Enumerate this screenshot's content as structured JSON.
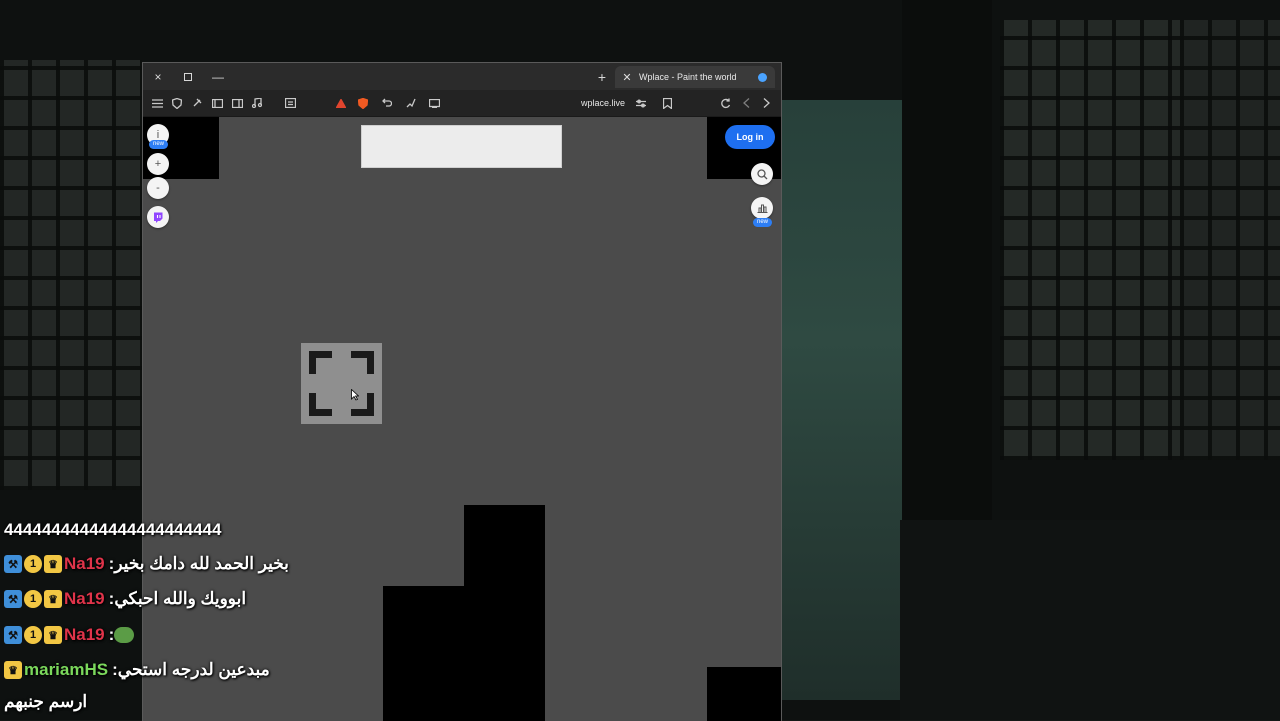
{
  "browser": {
    "tab_title": "Wplace - Paint the world",
    "url": "wplace.live",
    "new_tab_label": "+",
    "close_label": "×",
    "min_label": "—"
  },
  "page": {
    "login_label": "Log in",
    "left_badge": "new",
    "right_badge": "new",
    "info_glyph": "i",
    "zoom_in_glyph": "+",
    "zoom_out_glyph": "-"
  },
  "chat": {
    "lines": [
      {
        "user": "",
        "text": "44444444444444444444444"
      },
      {
        "user": "Na19",
        "sep": " : ",
        "text": "بخير الحمد لله دامك بخير"
      },
      {
        "user": "Na19",
        "sep": " : ",
        "text": "ابوويك والله احبكي"
      },
      {
        "user": "Na19",
        "sep": " : ",
        "text": ""
      },
      {
        "user": "mariamHS",
        "sep": " : ",
        "text": "مبدعين لدرجه استحي"
      },
      {
        "user": "",
        "text": "ارسم جنبهم"
      }
    ]
  },
  "colors": {
    "accent_blue": "#1e6ff0",
    "user_na19": "#e0344a",
    "user_mariam": "#7bd85c"
  }
}
